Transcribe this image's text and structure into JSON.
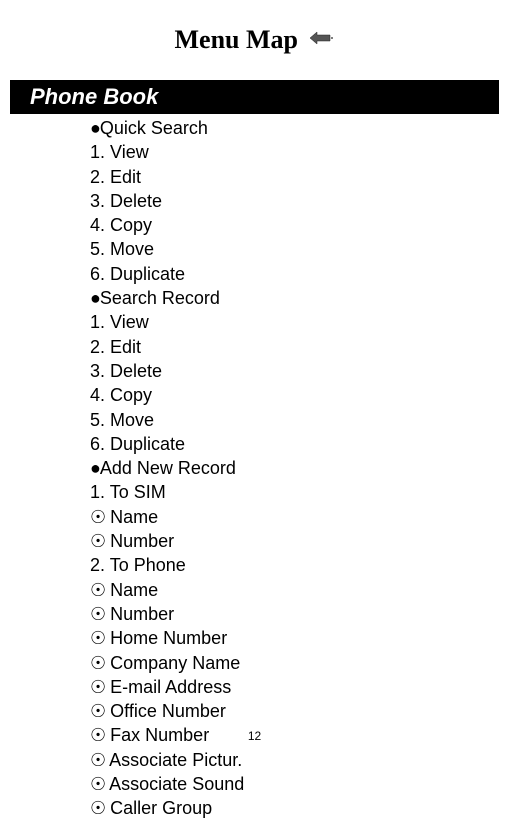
{
  "title": "Menu Map",
  "sectionHeader": "Phone Book",
  "items": [
    {
      "bullet": "●",
      "text": "Quick Search",
      "space": false
    },
    {
      "bullet": "",
      "text": "1. View",
      "space": false
    },
    {
      "bullet": "",
      "text": "2. Edit",
      "space": false
    },
    {
      "bullet": "",
      "text": "3. Delete",
      "space": false
    },
    {
      "bullet": "",
      "text": "4. Copy",
      "space": false
    },
    {
      "bullet": "",
      "text": "5. Move",
      "space": false
    },
    {
      "bullet": "",
      "text": "6. Duplicate",
      "space": false
    },
    {
      "bullet": "●",
      "text": "Search Record",
      "space": false
    },
    {
      "bullet": "",
      "text": "1. View",
      "space": false
    },
    {
      "bullet": "",
      "text": "2. Edit",
      "space": false
    },
    {
      "bullet": "",
      "text": "3. Delete",
      "space": false
    },
    {
      "bullet": "",
      "text": "4. Copy",
      "space": false
    },
    {
      "bullet": "",
      "text": "5. Move",
      "space": false
    },
    {
      "bullet": "",
      "text": "6. Duplicate",
      "space": false
    },
    {
      "bullet": "●",
      "text": "Add New Record",
      "space": false
    },
    {
      "bullet": "",
      "text": "1. To SIM",
      "space": false
    },
    {
      "bullet": "☉",
      "text": "Name",
      "space": true
    },
    {
      "bullet": "☉",
      "text": "Number",
      "space": true
    },
    {
      "bullet": "",
      "text": "2. To Phone",
      "space": false
    },
    {
      "bullet": "☉",
      "text": "Name",
      "space": true
    },
    {
      "bullet": "☉",
      "text": "Number",
      "space": true
    },
    {
      "bullet": "☉",
      "text": "Home Number",
      "space": true
    },
    {
      "bullet": "☉",
      "text": "Company Name",
      "space": true
    },
    {
      "bullet": "☉",
      "text": "E-mail Address",
      "space": true
    },
    {
      "bullet": "☉",
      "text": "Office Number",
      "space": true
    },
    {
      "bullet": "☉",
      "text": "Fax Number",
      "space": true
    },
    {
      "bullet": "☉",
      "text": "Associate Pictur.",
      "space": true
    },
    {
      "bullet": "☉",
      "text": "Associate Sound",
      "space": true
    },
    {
      "bullet": "☉",
      "text": "Caller Group",
      "space": true
    }
  ],
  "pageNumber": "12"
}
